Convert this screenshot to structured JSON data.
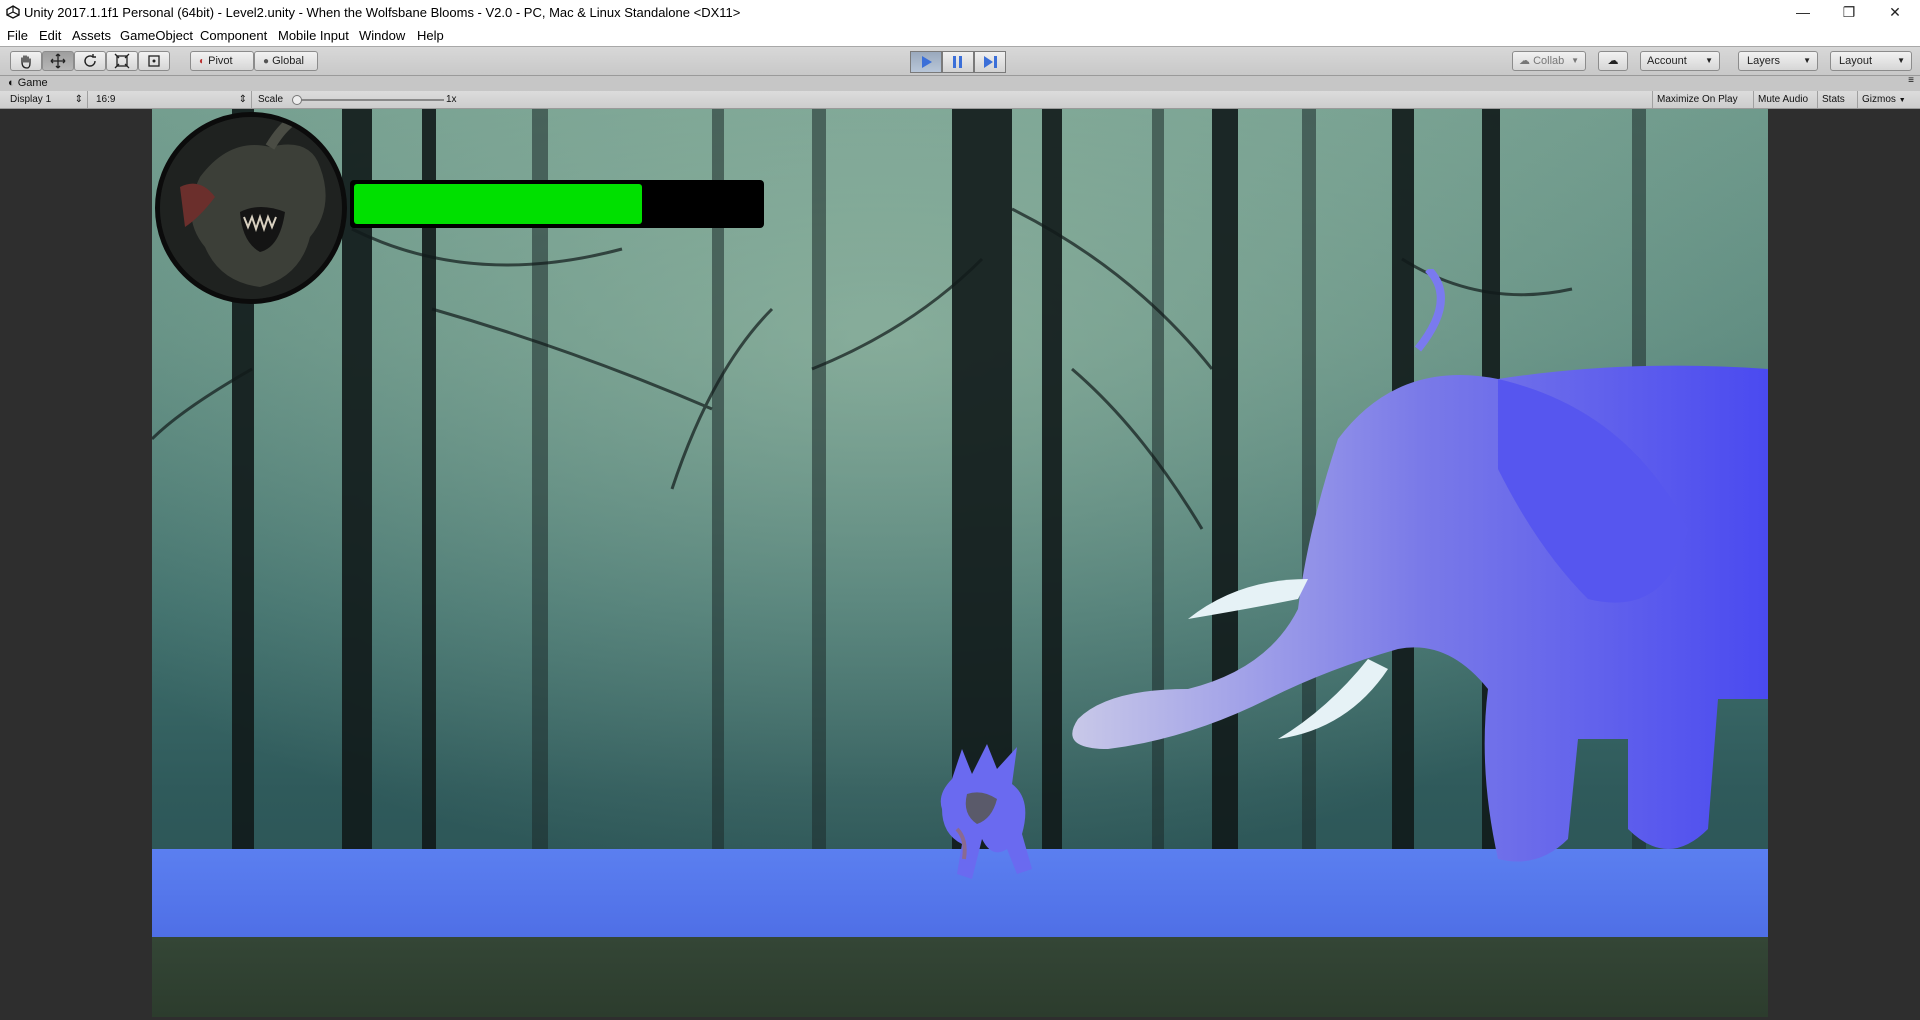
{
  "window": {
    "title": "Unity 2017.1.1f1 Personal (64bit) - Level2.unity - When the Wolfsbane Blooms - V2.0 - PC, Mac & Linux Standalone <DX11>",
    "minimize_glyph": "—",
    "maximize_glyph": "❐",
    "close_glyph": "✕"
  },
  "menu": {
    "items": [
      "File",
      "Edit",
      "Assets",
      "GameObject",
      "Component",
      "Mobile Input",
      "Window",
      "Help"
    ]
  },
  "toolbar": {
    "pivot_label": "Pivot",
    "global_label": "Global",
    "collab_label": "Collab",
    "account_label": "Account",
    "layers_label": "Layers",
    "layout_label": "Layout",
    "play_state": "playing"
  },
  "game_tab": {
    "label": "Game",
    "display": "Display 1",
    "aspect": "16:9",
    "scale_label": "Scale",
    "scale_value": "1x",
    "maximize_on_play": "Maximize On Play",
    "mute_audio": "Mute Audio",
    "stats": "Stats",
    "gizmos": "Gizmos"
  },
  "hud": {
    "health_fraction": 0.71,
    "health_color": "#00e000"
  },
  "colors": {
    "play_active": "#3b6fd8",
    "ground_blue": "#5b7ff0"
  }
}
